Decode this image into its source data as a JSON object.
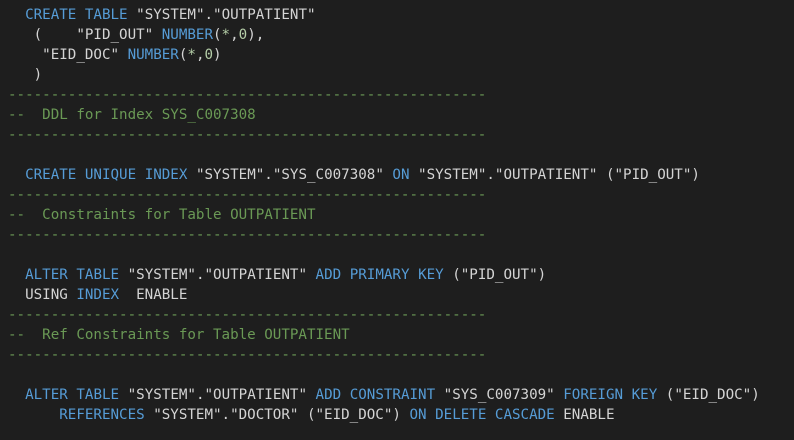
{
  "editor": {
    "theme_colors": {
      "background": "#1e1e1e",
      "keyword": "#569cd6",
      "text": "#d4d4d4",
      "number": "#b5cea8",
      "comment": "#6a9955"
    },
    "lines": [
      [
        {
          "t": "  ",
          "c": "txt"
        },
        {
          "t": "CREATE",
          "c": "kw"
        },
        {
          "t": " ",
          "c": "txt"
        },
        {
          "t": "TABLE",
          "c": "kw"
        },
        {
          "t": " \"SYSTEM\".\"OUTPATIENT\"",
          "c": "txt"
        }
      ],
      [
        {
          "t": "   (    \"PID_OUT\" ",
          "c": "txt"
        },
        {
          "t": "NUMBER",
          "c": "kw"
        },
        {
          "t": "(",
          "c": "txt"
        },
        {
          "t": "*",
          "c": "num"
        },
        {
          "t": ",",
          "c": "txt"
        },
        {
          "t": "0",
          "c": "num"
        },
        {
          "t": "),",
          "c": "txt"
        }
      ],
      [
        {
          "t": "    \"EID_DOC\" ",
          "c": "txt"
        },
        {
          "t": "NUMBER",
          "c": "kw"
        },
        {
          "t": "(",
          "c": "txt"
        },
        {
          "t": "*",
          "c": "num"
        },
        {
          "t": ",",
          "c": "txt"
        },
        {
          "t": "0",
          "c": "num"
        },
        {
          "t": ")",
          "c": "txt"
        }
      ],
      [
        {
          "t": "   )",
          "c": "txt"
        }
      ],
      [
        {
          "t": "--------------------------------------------------------",
          "c": "cmt"
        }
      ],
      [
        {
          "t": "--  DDL for Index SYS_C007308",
          "c": "cmt"
        }
      ],
      [
        {
          "t": "--------------------------------------------------------",
          "c": "cmt"
        }
      ],
      [],
      [
        {
          "t": "  ",
          "c": "txt"
        },
        {
          "t": "CREATE",
          "c": "kw"
        },
        {
          "t": " ",
          "c": "txt"
        },
        {
          "t": "UNIQUE",
          "c": "kw"
        },
        {
          "t": " ",
          "c": "txt"
        },
        {
          "t": "INDEX",
          "c": "kw"
        },
        {
          "t": " \"SYSTEM\".\"SYS_C007308\" ",
          "c": "txt"
        },
        {
          "t": "ON",
          "c": "kw"
        },
        {
          "t": " \"SYSTEM\".\"OUTPATIENT\" (\"PID_OUT\")",
          "c": "txt"
        }
      ],
      [
        {
          "t": "--------------------------------------------------------",
          "c": "cmt"
        }
      ],
      [
        {
          "t": "--  Constraints for Table OUTPATIENT",
          "c": "cmt"
        }
      ],
      [
        {
          "t": "--------------------------------------------------------",
          "c": "cmt"
        }
      ],
      [],
      [
        {
          "t": "  ",
          "c": "txt"
        },
        {
          "t": "ALTER",
          "c": "kw"
        },
        {
          "t": " ",
          "c": "txt"
        },
        {
          "t": "TABLE",
          "c": "kw"
        },
        {
          "t": " \"SYSTEM\".\"OUTPATIENT\" ",
          "c": "txt"
        },
        {
          "t": "ADD",
          "c": "kw"
        },
        {
          "t": " ",
          "c": "txt"
        },
        {
          "t": "PRIMARY",
          "c": "kw"
        },
        {
          "t": " ",
          "c": "txt"
        },
        {
          "t": "KEY",
          "c": "kw"
        },
        {
          "t": " (\"PID_OUT\")",
          "c": "txt"
        }
      ],
      [
        {
          "t": "  USING ",
          "c": "txt"
        },
        {
          "t": "INDEX",
          "c": "kw"
        },
        {
          "t": "  ENABLE",
          "c": "txt"
        }
      ],
      [
        {
          "t": "--------------------------------------------------------",
          "c": "cmt"
        }
      ],
      [
        {
          "t": "--  Ref Constraints for Table OUTPATIENT",
          "c": "cmt"
        }
      ],
      [
        {
          "t": "--------------------------------------------------------",
          "c": "cmt"
        }
      ],
      [],
      [
        {
          "t": "  ",
          "c": "txt"
        },
        {
          "t": "ALTER",
          "c": "kw"
        },
        {
          "t": " ",
          "c": "txt"
        },
        {
          "t": "TABLE",
          "c": "kw"
        },
        {
          "t": " \"SYSTEM\".\"OUTPATIENT\" ",
          "c": "txt"
        },
        {
          "t": "ADD",
          "c": "kw"
        },
        {
          "t": " ",
          "c": "txt"
        },
        {
          "t": "CONSTRAINT",
          "c": "kw"
        },
        {
          "t": " \"SYS_C007309\" ",
          "c": "txt"
        },
        {
          "t": "FOREIGN",
          "c": "kw"
        },
        {
          "t": " ",
          "c": "txt"
        },
        {
          "t": "KEY",
          "c": "kw"
        },
        {
          "t": " (\"EID_DOC\")",
          "c": "txt"
        }
      ],
      [
        {
          "t": "      ",
          "c": "txt"
        },
        {
          "t": "REFERENCES",
          "c": "kw"
        },
        {
          "t": " \"SYSTEM\".\"DOCTOR\" (\"EID_DOC\") ",
          "c": "txt"
        },
        {
          "t": "ON",
          "c": "kw"
        },
        {
          "t": " ",
          "c": "txt"
        },
        {
          "t": "DELETE",
          "c": "kw"
        },
        {
          "t": " ",
          "c": "txt"
        },
        {
          "t": "CASCADE",
          "c": "kw"
        },
        {
          "t": " ENABLE",
          "c": "txt"
        }
      ]
    ]
  }
}
